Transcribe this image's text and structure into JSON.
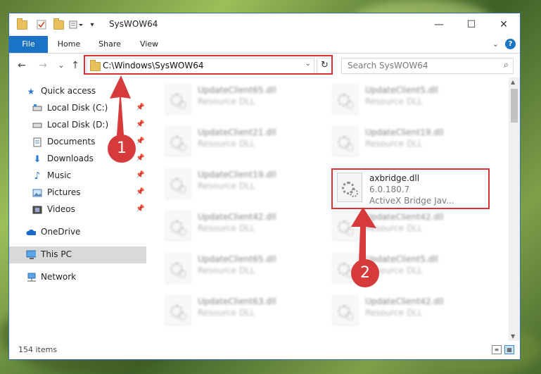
{
  "window": {
    "title": "SysWOW64",
    "controls": {
      "minimize": "—",
      "maximize": "☐",
      "close": "✕"
    }
  },
  "ribbon": {
    "tabs": [
      {
        "label": "File"
      },
      {
        "label": "Home"
      },
      {
        "label": "Share"
      },
      {
        "label": "View"
      }
    ],
    "help": "?"
  },
  "nav": {
    "back": "←",
    "forward": "→",
    "recent": "⌄",
    "up": "↑",
    "address": "C:\\Windows\\SysWOW64",
    "refresh": "↻",
    "search_placeholder": "Search SysWOW64"
  },
  "sidebar": {
    "items": [
      {
        "label": "Quick access",
        "icon": "star-icon"
      },
      {
        "label": "Local Disk (C:)",
        "icon": "drive-icon",
        "pinned": true
      },
      {
        "label": "Local Disk (D:)",
        "icon": "drive-icon",
        "pinned": true
      },
      {
        "label": "Documents",
        "icon": "document-icon",
        "pinned": true
      },
      {
        "label": "Downloads",
        "icon": "download-icon",
        "pinned": true
      },
      {
        "label": "Music",
        "icon": "music-icon",
        "pinned": true
      },
      {
        "label": "Pictures",
        "icon": "pictures-icon",
        "pinned": true
      },
      {
        "label": "Videos",
        "icon": "video-icon",
        "pinned": true
      },
      {
        "label": "OneDrive",
        "icon": "cloud-icon"
      },
      {
        "label": "This PC",
        "icon": "computer-icon",
        "selected": true
      },
      {
        "label": "Network",
        "icon": "network-icon"
      }
    ]
  },
  "files": [
    {
      "name": "UpdateClient65.dll",
      "type": "Resource DLL",
      "col": 0,
      "row": 0
    },
    {
      "name": "UpdateClient5.dll",
      "type": "Resource DLL",
      "col": 1,
      "row": 0
    },
    {
      "name": "UpdateClient21.dll",
      "type": "Resource DLL",
      "col": 0,
      "row": 1
    },
    {
      "name": "UpdateClient19.dll",
      "type": "Resource DLL",
      "col": 1,
      "row": 1
    },
    {
      "name": "UpdateClient19.dll",
      "type": "Resource DLL",
      "col": 0,
      "row": 2
    },
    {
      "name": "axbridge.dll",
      "version": "6.0.180.7",
      "type": "ActiveX Bridge  Jav...",
      "col": 1,
      "row": 2,
      "highlighted": true
    },
    {
      "name": "UpdateClient42.dll",
      "type": "Resource DLL",
      "col": 0,
      "row": 3
    },
    {
      "name": "UpdateClient42.dll",
      "type": "Resource DLL",
      "col": 1,
      "row": 3
    },
    {
      "name": "UpdateClient65.dll",
      "type": "Resource DLL",
      "col": 0,
      "row": 4
    },
    {
      "name": "UpdateClient5.dll",
      "type": "Resource DLL",
      "col": 1,
      "row": 4
    },
    {
      "name": "UpdateClient63.dll",
      "type": "Resource DLL",
      "col": 0,
      "row": 5
    },
    {
      "name": "UpdateClient42.dll",
      "type": "Resource DLL",
      "col": 1,
      "row": 5
    }
  ],
  "status": {
    "item_count": "154 items"
  },
  "annotations": {
    "callout1": "1",
    "callout2": "2",
    "color": "#d63a3a"
  }
}
